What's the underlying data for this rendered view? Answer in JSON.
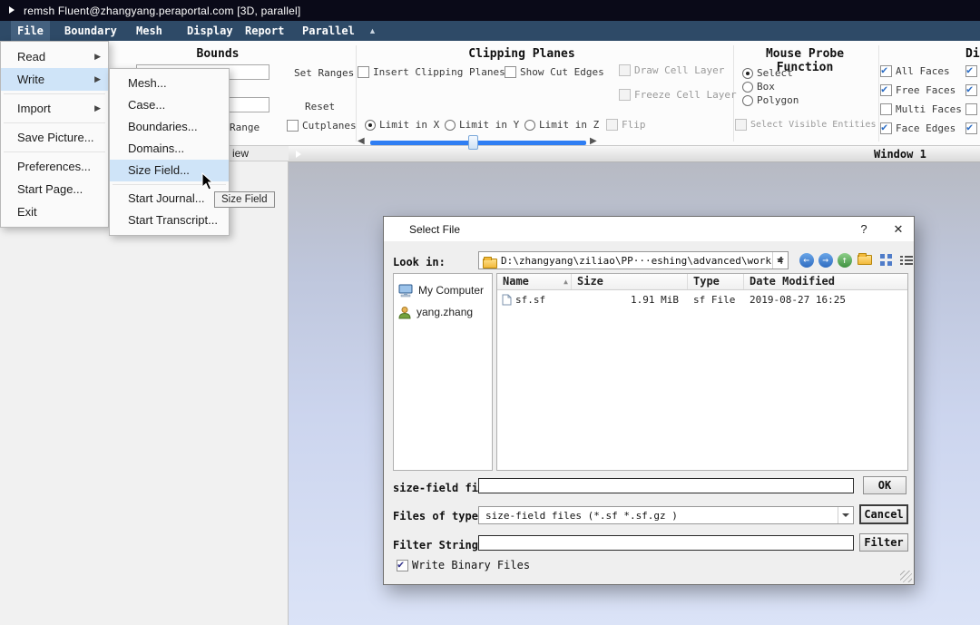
{
  "icons": {
    "submenu_arrow": "▶",
    "menubar_caret": "▲",
    "slider_left": "◀",
    "slider_right": "▶",
    "sort_asc": "▲",
    "nav_back": "←",
    "nav_forward": "→",
    "nav_up": "↑",
    "help": "?",
    "close": "✕"
  },
  "title_bar": {
    "title": "remsh Fluent@zhangyang.peraportal.com  [3D, parallel]"
  },
  "menu_bar": {
    "items": [
      "File",
      "Boundary",
      "Mesh",
      "Display",
      "Report",
      "Parallel"
    ]
  },
  "file_menu": {
    "items": [
      {
        "label": "Read",
        "submenu": true
      },
      {
        "label": "Write",
        "submenu": true,
        "highlighted": true
      },
      {
        "label": "Import",
        "submenu": true
      },
      {
        "label": "Save Picture..."
      },
      {
        "label": "Preferences..."
      },
      {
        "label": "Start Page..."
      },
      {
        "label": "Exit"
      }
    ]
  },
  "write_submenu": {
    "items": [
      {
        "label": "Mesh..."
      },
      {
        "label": "Case..."
      },
      {
        "label": "Boundaries..."
      },
      {
        "label": "Domains..."
      },
      {
        "label": "Size Field...",
        "highlighted": true
      },
      {
        "label": "Start Journal..."
      },
      {
        "label": "Start Transcript..."
      }
    ]
  },
  "tooltip": {
    "text": "Size Field"
  },
  "ribbon": {
    "bounds": {
      "title": "Bounds",
      "set_ranges_label": "Set Ranges",
      "reset_label": "Reset",
      "range_label": "Range",
      "cutplanes_label": "Cutplanes",
      "cutplanes_checked": false
    },
    "clipping_planes": {
      "title": "Clipping Planes",
      "insert_label": "Insert Clipping Planes",
      "show_cut_label": "Show Cut Edges",
      "draw_cell_label": "Draw Cell Layer",
      "freeze_cell_label": "Freeze Cell Layer",
      "limit_x_label": "Limit in X",
      "limit_y_label": "Limit in Y",
      "limit_z_label": "Limit in Z",
      "flip_label": "Flip",
      "limit_selected": "Limit in X"
    },
    "mouse_probe": {
      "title": "Mouse Probe Function",
      "select_label": "Select",
      "box_label": "Box",
      "polygon_label": "Polygon",
      "selected": "Select",
      "select_visible_label": "Select Visible Entities"
    },
    "faces": {
      "items": [
        {
          "label": "All Faces",
          "checked": true
        },
        {
          "label": "Free Faces",
          "checked": true
        },
        {
          "label": "Multi Faces",
          "checked": false
        },
        {
          "label": "Face Edges",
          "checked": true
        }
      ]
    },
    "clipped_group": {
      "title_fragment": "Di"
    }
  },
  "left_panel": {
    "tab_fragment": "iew"
  },
  "graphics_window": {
    "title": "Window 1"
  },
  "dialog": {
    "title": "Select File",
    "look_in_label": "Look in:",
    "path": "D:\\zhangyang\\ziliao\\PP···eshing\\advanced\\work 4",
    "places": [
      "My Computer",
      "yang.zhang"
    ],
    "file_table": {
      "headers": [
        "Name",
        "Size",
        "Type",
        "Date Modified"
      ],
      "rows": [
        {
          "name": "sf.sf",
          "size": "1.91 MiB",
          "type": "sf File",
          "date_modified": "2019-08-27 16:25"
        }
      ]
    },
    "size_field_label": "size-field file",
    "size_field_value": "",
    "files_of_type_label": "Files of type:",
    "files_of_type_value": "size-field files (*.sf *.sf.gz )",
    "filter_string_label": "Filter String",
    "filter_string_value": "",
    "write_binary_label": "Write Binary Files",
    "write_binary_checked": true,
    "buttons": {
      "ok": "OK",
      "cancel": "Cancel",
      "filter": "Filter"
    }
  }
}
